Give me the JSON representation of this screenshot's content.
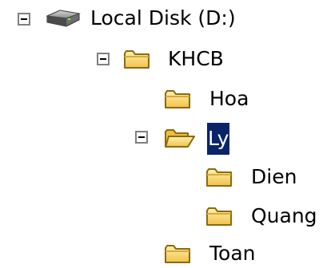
{
  "tree": {
    "root": {
      "label": "Local Disk (D:)",
      "icon": "hard-drive-icon",
      "expanded": true,
      "children": [
        {
          "label": "KHCB",
          "icon": "folder-icon",
          "expanded": true,
          "children": [
            {
              "label": "Hoa",
              "icon": "folder-icon"
            },
            {
              "label": "Ly",
              "icon": "folder-open-icon",
              "expanded": true,
              "selected": true,
              "children": [
                {
                  "label": "Dien",
                  "icon": "folder-icon"
                },
                {
                  "label": "Quang",
                  "icon": "folder-icon"
                }
              ]
            },
            {
              "label": "Toan",
              "icon": "folder-icon"
            }
          ]
        }
      ]
    }
  },
  "colors": {
    "selection_background": "#0a246a",
    "selection_text": "#ffffff",
    "folder_yellow": "#f8d35b",
    "folder_outline": "#8a6a10"
  }
}
